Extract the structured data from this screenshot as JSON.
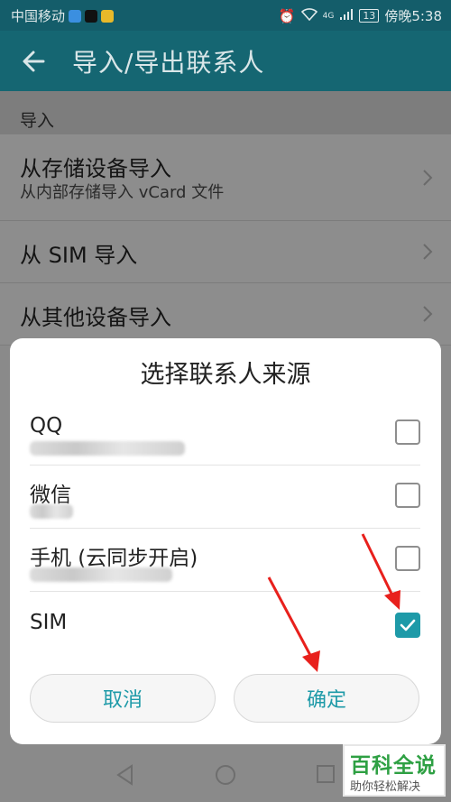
{
  "status_bar": {
    "carrier": "中国移动",
    "time": "傍晚5:38",
    "signal_label": "4G",
    "battery": "13"
  },
  "header": {
    "title": "导入/导出联系人"
  },
  "import_section": {
    "heading": "导入",
    "items": [
      {
        "title": "从存储设备导入",
        "subtitle": "从内部存储导入 vCard 文件"
      },
      {
        "title": "从 SIM 导入"
      },
      {
        "title": "从其他设备导入"
      }
    ]
  },
  "dialog": {
    "title": "选择联系人来源",
    "options": [
      {
        "name": "QQ",
        "checked": false
      },
      {
        "name": "微信",
        "checked": false
      },
      {
        "name": "手机 (云同步开启)",
        "checked": false
      },
      {
        "name": "SIM",
        "checked": true
      }
    ],
    "cancel_label": "取消",
    "confirm_label": "确定"
  },
  "watermark": {
    "brand": "百科全说",
    "tagline": "助你轻松解决"
  },
  "colors": {
    "accent": "#1e9aa8",
    "header_bg": "#156672",
    "arrow": "#e8201c"
  }
}
